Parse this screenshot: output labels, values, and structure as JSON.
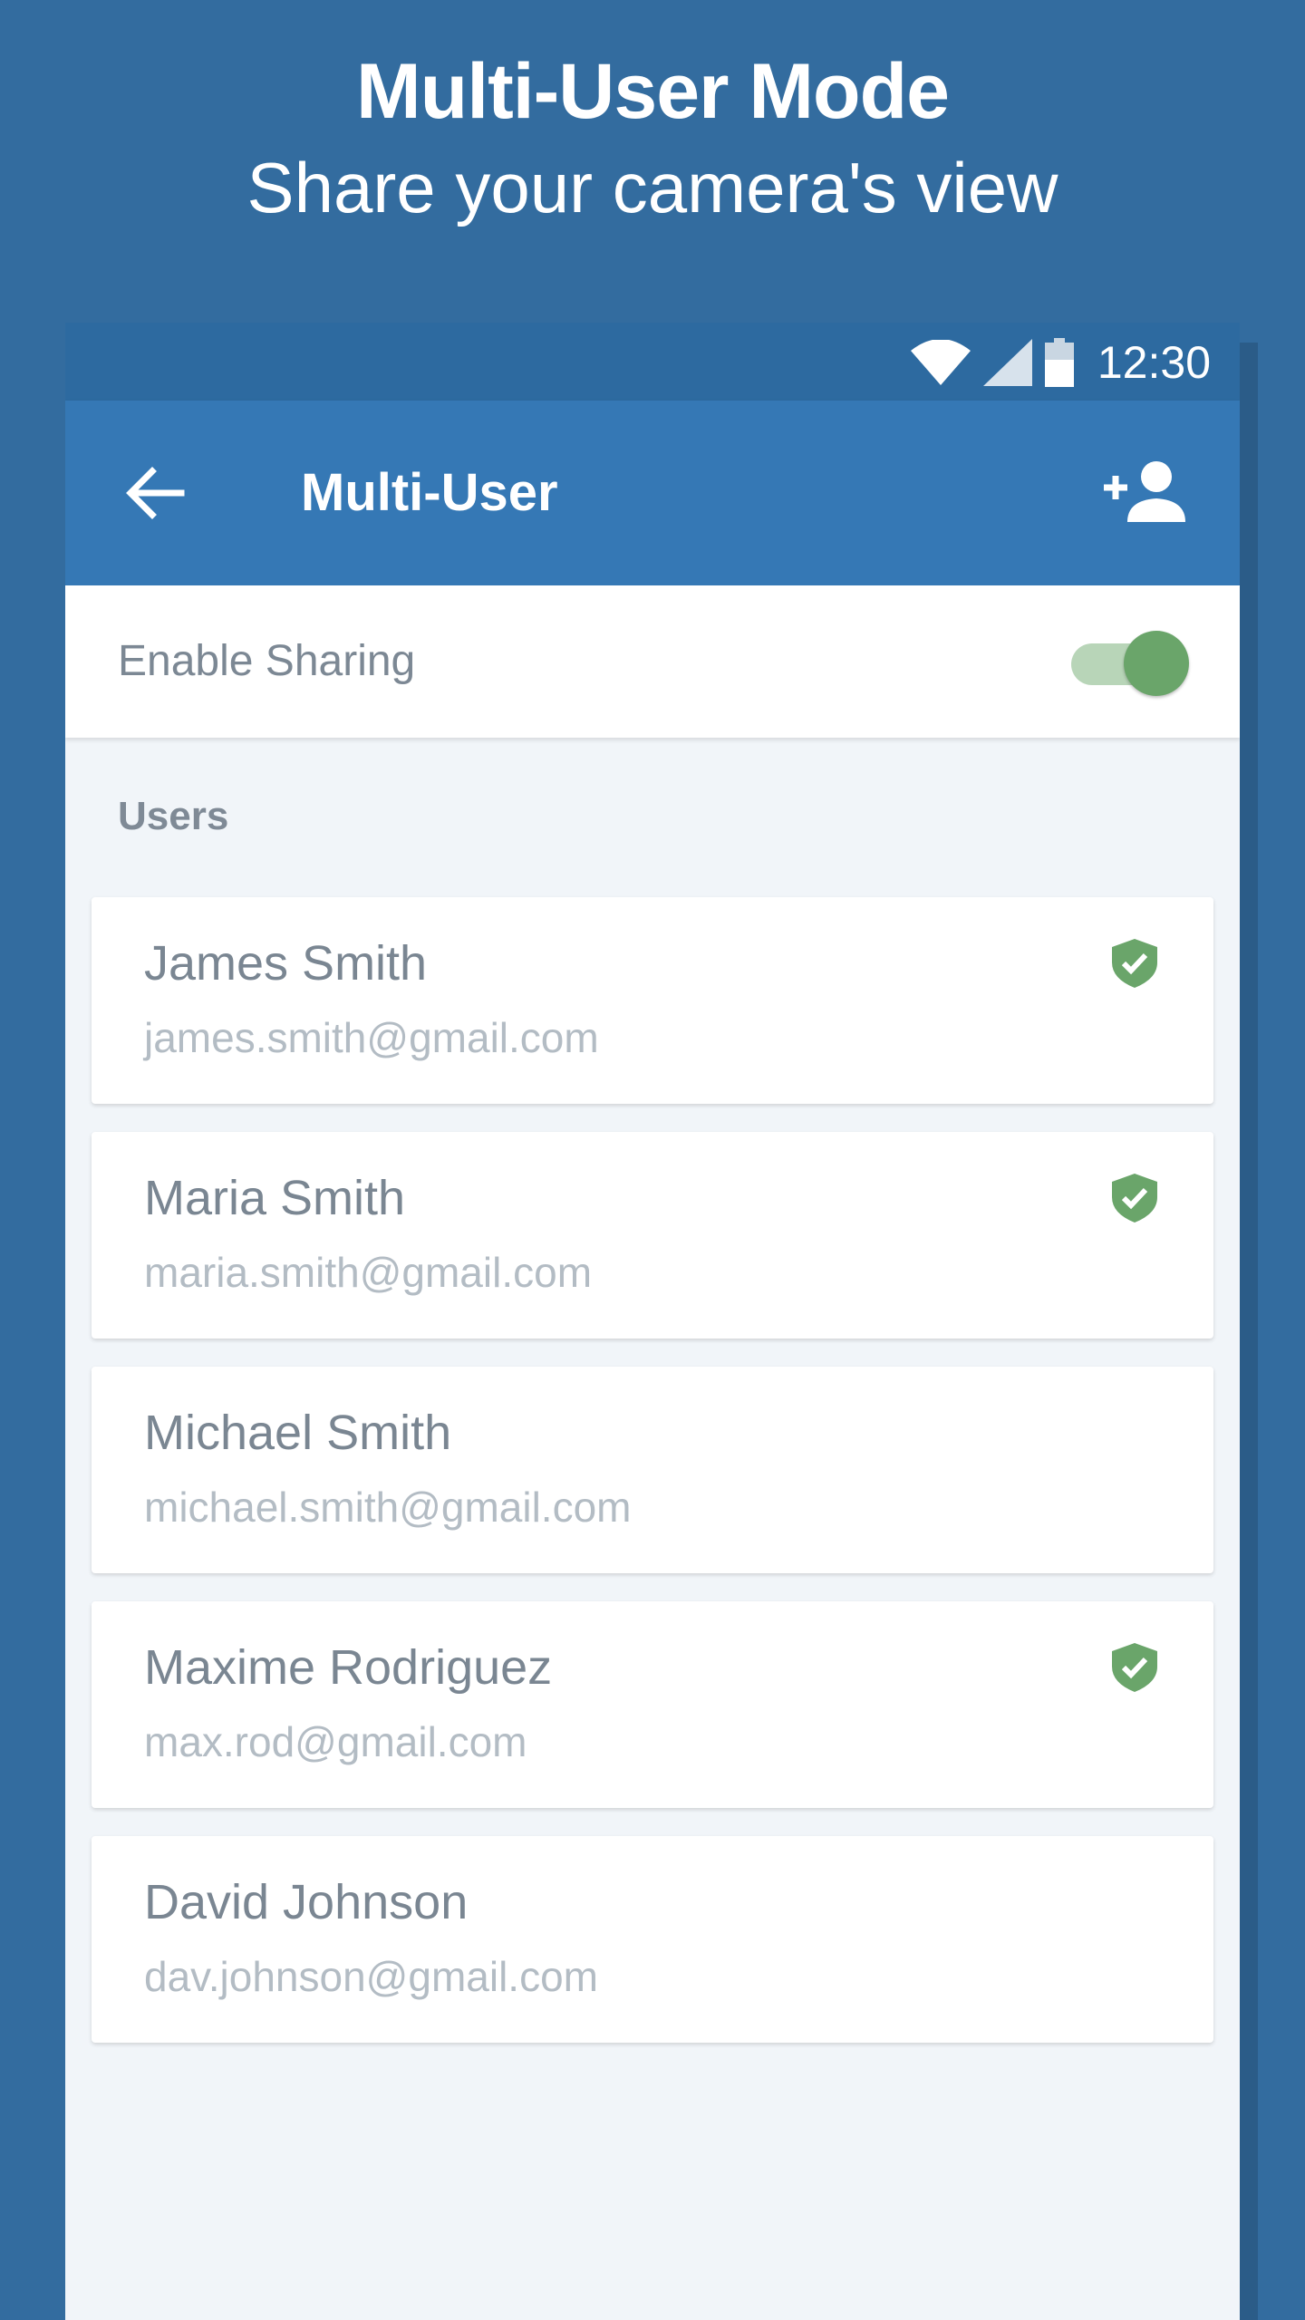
{
  "promo": {
    "title": "Multi-User Mode",
    "subtitle": "Share your camera's view"
  },
  "status_bar": {
    "time": "12:30",
    "icons": [
      "wifi-icon",
      "cell-signal-icon",
      "battery-icon"
    ]
  },
  "app_bar": {
    "title": "Multi-User",
    "back_icon": "arrow-back-icon",
    "action_icon": "person-add-icon"
  },
  "settings": {
    "enable_sharing_label": "Enable Sharing",
    "enable_sharing_on": true
  },
  "users_section": {
    "header": "Users",
    "users": [
      {
        "name": "James Smith",
        "email": "james.smith@gmail.com",
        "verified": true
      },
      {
        "name": "Maria Smith",
        "email": "maria.smith@gmail.com",
        "verified": true
      },
      {
        "name": "Michael Smith",
        "email": "michael.smith@gmail.com",
        "verified": false
      },
      {
        "name": "Maxime Rodriguez",
        "email": "max.rod@gmail.com",
        "verified": true
      },
      {
        "name": "David Johnson",
        "email": "dav.johnson@gmail.com",
        "verified": false
      }
    ]
  },
  "colors": {
    "background": "#336c9f",
    "status_bar": "#2d6aa0",
    "app_bar": "#3578b5",
    "accent_green": "#6aa56a",
    "verified_green": "#6aa56a"
  }
}
